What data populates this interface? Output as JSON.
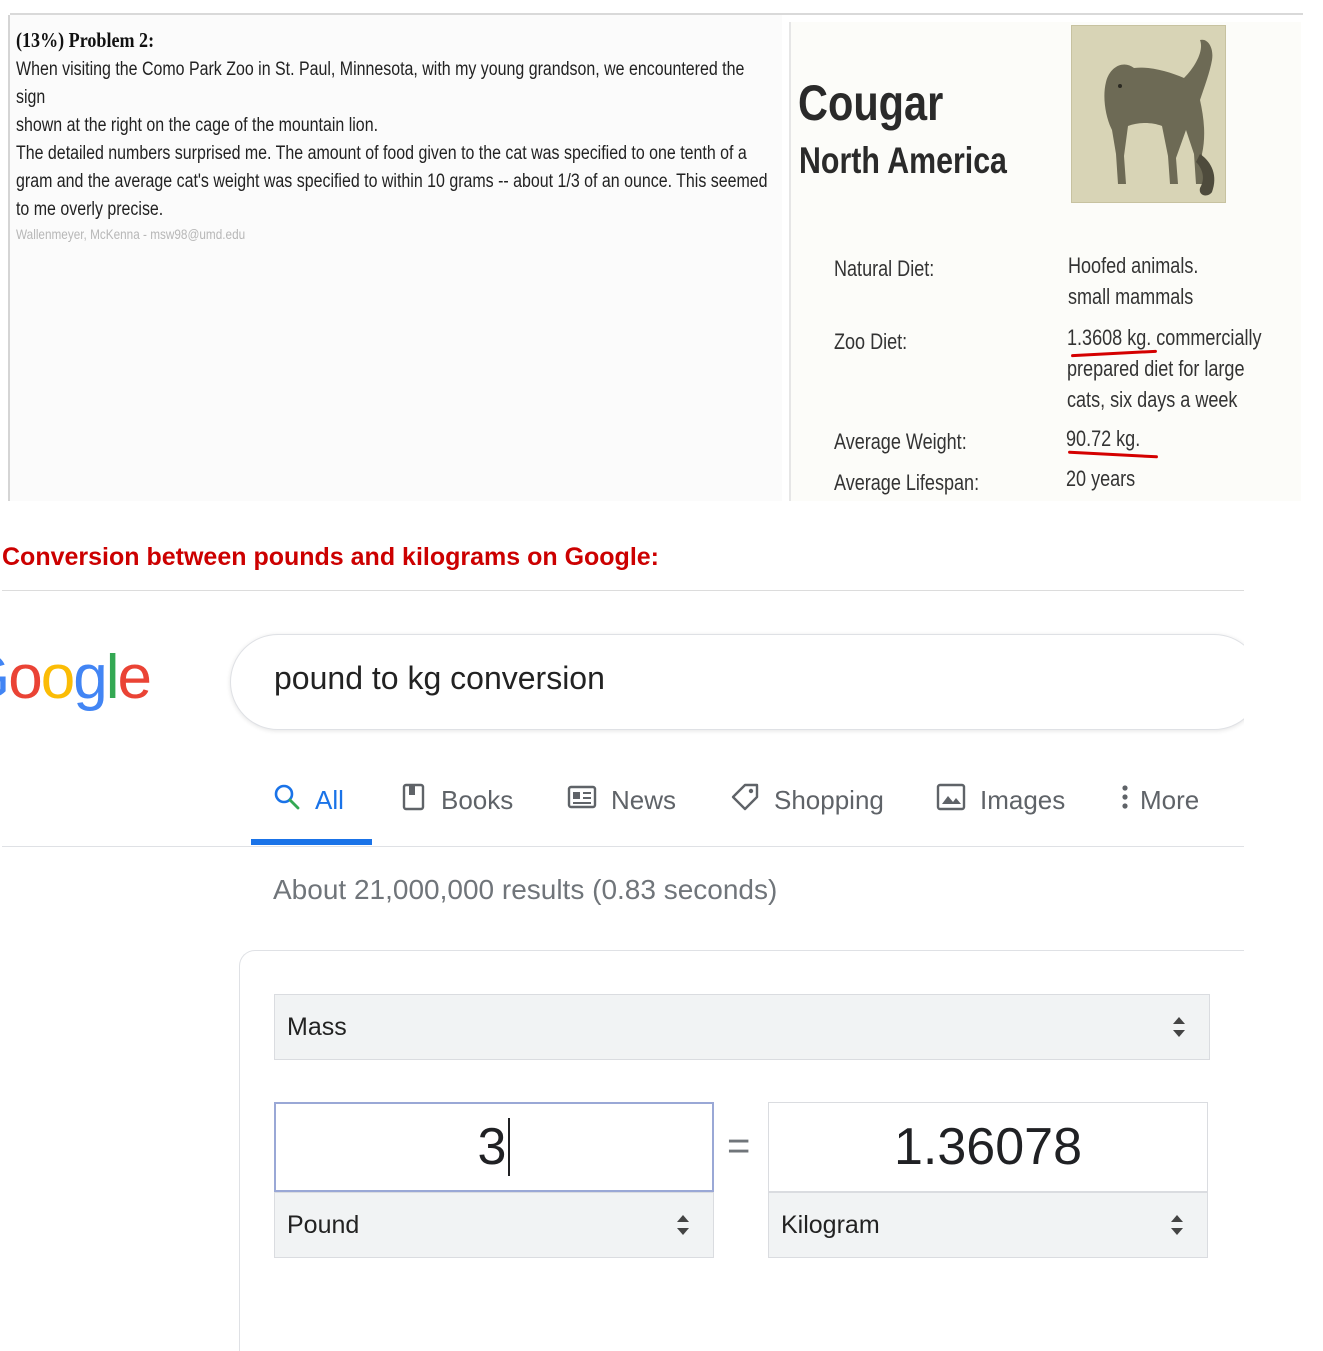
{
  "problem": {
    "title": "(13%)  Problem 2:",
    "para1_line1": "When visiting the Como Park Zoo in St. Paul, Minnesota, with my young grandson, we encountered the sign",
    "para1_line2": "shown at the right on the cage of the mountain lion.",
    "para2_line1": "The detailed numbers surprised me. The amount of food given to the cat was specified to one tenth of a",
    "para2_line2": "gram and the average cat's weight was specified to within 10 grams -- about 1/3 of an ounce. This seemed",
    "para2_line3": "to me overly precise.",
    "credit": "Wallenmeyer, McKenna - msw98@umd.edu"
  },
  "sign": {
    "title": "Cougar",
    "region": "North America",
    "natural_diet_label": "Natural Diet:",
    "natural_diet_line1": "Hoofed animals.",
    "natural_diet_line2": "small mammals",
    "zoo_diet_label": "Zoo Diet:",
    "zoo_diet_line1": "1.3608 kg. commercially",
    "zoo_diet_line2": "prepared diet for large",
    "zoo_diet_line3": "cats, six days a week",
    "weight_label": "Average Weight:",
    "weight_value": "90.72 kg.",
    "lifespan_label": "Average Lifespan:",
    "lifespan_value": "20 years"
  },
  "heading": "Conversion between pounds and kilograms on Google:",
  "google": {
    "logo_text": "Google",
    "logo_colors": [
      "#4285F4",
      "#EA4335",
      "#FBBC05",
      "#4285F4",
      "#34A853",
      "#EA4335"
    ],
    "search_query": "pound to kg conversion",
    "tabs": {
      "all": "All",
      "books": "Books",
      "news": "News",
      "shopping": "Shopping",
      "images": "Images",
      "more": "More"
    },
    "results_stats": "About 21,000,000 results (0.83 seconds)",
    "converter": {
      "category": "Mass",
      "from_value": "3",
      "from_unit": "Pound",
      "equals": "=",
      "to_value": "1.36078",
      "to_unit": "Kilogram"
    }
  }
}
